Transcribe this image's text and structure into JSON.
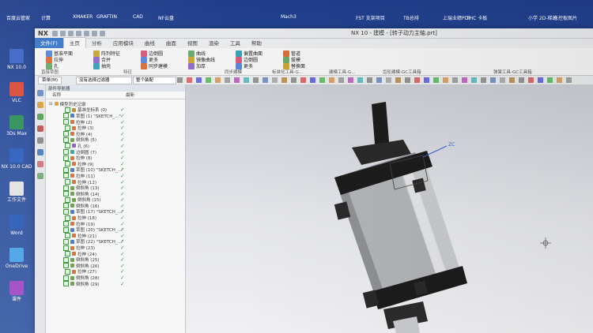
{
  "desktop": {
    "top_labels": [
      "百度云管家",
      "计算",
      "XMAKER",
      "GRAFTIN",
      "CAD",
      "NF云盘",
      "Mach3",
      "FST 支架项目",
      "TB总排",
      "上瑞业绩PDF",
      "THC 卡板",
      "小学 2D-梯的",
      "总控板图片"
    ],
    "side_labels": [
      "NX 10.0",
      "VLC",
      "3Ds Max",
      "NX 10.0 CAD",
      "工作文件",
      "Word",
      "OneDrive",
      "课件"
    ]
  },
  "window": {
    "logo": "NX",
    "title": "NX 10 - 建模 - [转子动力主轴.prt]"
  },
  "tabs": [
    {
      "label": "文件(F)",
      "kind": "file"
    },
    {
      "label": "主页",
      "kind": "active"
    },
    {
      "label": "分析",
      "kind": ""
    },
    {
      "label": "应用模块",
      "kind": ""
    },
    {
      "label": "曲线",
      "kind": ""
    },
    {
      "label": "曲面",
      "kind": ""
    },
    {
      "label": "视图",
      "kind": ""
    },
    {
      "label": "渲染",
      "kind": ""
    },
    {
      "label": "工具",
      "kind": ""
    },
    {
      "label": "帮助",
      "kind": ""
    }
  ],
  "ribbon": {
    "items": [
      "基准平面",
      "拉伸",
      "孔",
      "阵列特征",
      "合并",
      "抽壳",
      "边倒圆",
      "更多",
      "同步建模",
      "曲线",
      "镜像曲线",
      "加厚",
      "偏置曲面",
      "边倒圆",
      "更多",
      "管道",
      "拔模",
      "替换面"
    ],
    "groups": [
      "直接草图",
      "特征",
      "同步建模",
      "标准化工具-G...",
      "建模工具-G...",
      "齿轮建模-GC工具箱",
      "弹簧工具-GC工具箱"
    ]
  },
  "toolbar2": {
    "menu": "菜单(M)",
    "filter": "没有选择过滤器",
    "assembly": "整个装配"
  },
  "navigator": {
    "title": "部件导航器",
    "col_name": "名称",
    "col_status": "最新",
    "root": "模型历史记录",
    "items": [
      "基准坐标系 (0)",
      "草图 (1) \"SKETCH_...\"",
      "拉伸 (2)",
      "拉伸 (3)",
      "拉伸 (4)",
      "倒斜角 (5)",
      "孔 (6)",
      "边倒圆 (7)",
      "拉伸 (8)",
      "拉伸 (9)",
      "草图 (10) \"SKETCH_...\"",
      "拉伸 (11)",
      "拉伸 (12)",
      "倒斜角 (13)",
      "倒斜角 (14)",
      "倒斜角 (15)",
      "倒斜角 (16)",
      "草图 (17) \"SKETCH_...\"",
      "拉伸 (18)",
      "拉伸 (19)",
      "草图 (20) \"SKETCH_...\"",
      "拉伸 (21)",
      "草图 (22) \"SKETCH_...\"",
      "拉伸 (23)",
      "拉伸 (24)",
      "倒斜角 (25)",
      "倒斜角 (26)",
      "拉伸 (27)",
      "倒斜角 (28)",
      "倒斜角 (29)"
    ]
  },
  "viewport": {
    "model": "spindle-motor-model",
    "axis_label": "ZC"
  },
  "colors": {
    "desktop": "#2d4f9c",
    "file_tab": "#3a77c4",
    "ok_check": "#2ea52e",
    "model_body": "#a9abae",
    "model_dark": "#1c1c1c"
  }
}
